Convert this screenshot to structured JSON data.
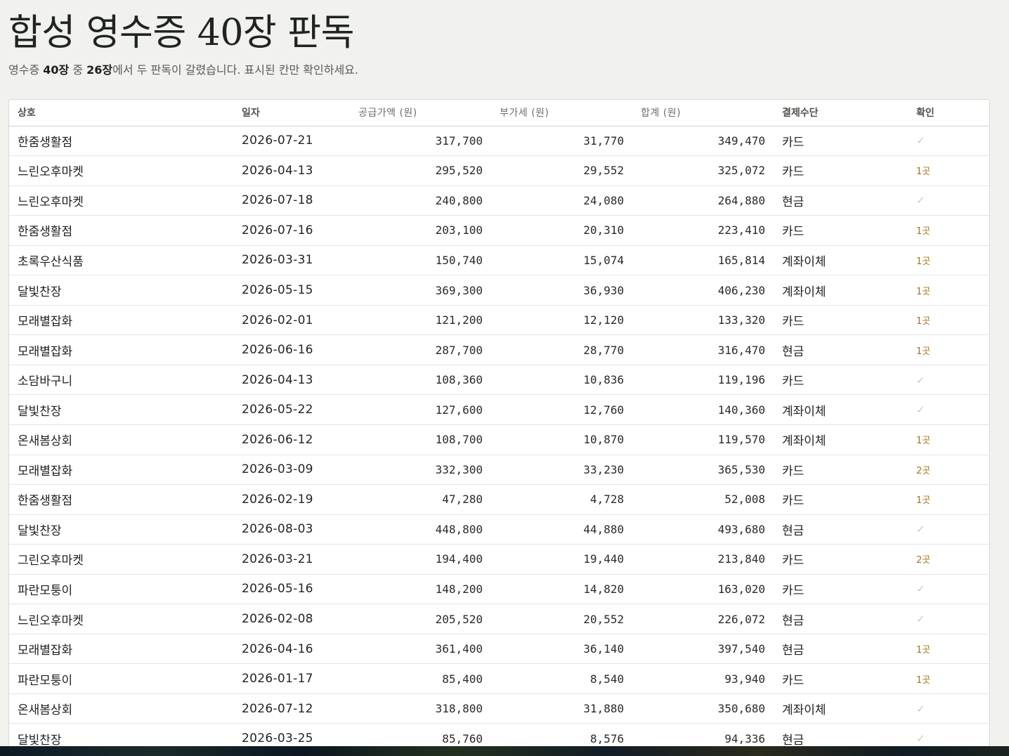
{
  "title": "합성 영수증 40장 판독",
  "subtitle": {
    "prefix": "영수증 ",
    "total": "40장",
    "middle": " 중 ",
    "disputed": "26장",
    "suffix": "에서 두 판독이 갈렸습니다. 표시된 칸만 확인하세요."
  },
  "table": {
    "columns": {
      "vendor": "상호",
      "date": "일자",
      "supply": "공급가액 (원)",
      "vat": "부가세 (원)",
      "total": "합계 (원)",
      "payment": "결제수단",
      "check": "확인"
    },
    "rows": [
      {
        "vendor": "한줌생활점",
        "date": "2026-07-21",
        "supply": "317,700",
        "vat": "31,770",
        "total": "349,470",
        "payment": "카드",
        "check": "✓",
        "flag": false
      },
      {
        "vendor": "느린오후마켓",
        "date": "2026-04-13",
        "supply": "295,520",
        "vat": "29,552",
        "total": "325,072",
        "payment": "카드",
        "check": "1곳",
        "flag": true
      },
      {
        "vendor": "느린오후마켓",
        "date": "2026-07-18",
        "supply": "240,800",
        "vat": "24,080",
        "total": "264,880",
        "payment": "현금",
        "check": "✓",
        "flag": false
      },
      {
        "vendor": "한줌생활점",
        "date": "2026-07-16",
        "supply": "203,100",
        "vat": "20,310",
        "total": "223,410",
        "payment": "카드",
        "check": "1곳",
        "flag": true
      },
      {
        "vendor": "초록우산식품",
        "date": "2026-03-31",
        "supply": "150,740",
        "vat": "15,074",
        "total": "165,814",
        "payment": "계좌이체",
        "check": "1곳",
        "flag": true
      },
      {
        "vendor": "달빛찬장",
        "date": "2026-05-15",
        "supply": "369,300",
        "vat": "36,930",
        "total": "406,230",
        "payment": "계좌이체",
        "check": "1곳",
        "flag": true
      },
      {
        "vendor": "모래별잡화",
        "date": "2026-02-01",
        "supply": "121,200",
        "vat": "12,120",
        "total": "133,320",
        "payment": "카드",
        "check": "1곳",
        "flag": true
      },
      {
        "vendor": "모래별잡화",
        "date": "2026-06-16",
        "supply": "287,700",
        "vat": "28,770",
        "total": "316,470",
        "payment": "현금",
        "check": "1곳",
        "flag": true
      },
      {
        "vendor": "소담바구니",
        "date": "2026-04-13",
        "supply": "108,360",
        "vat": "10,836",
        "total": "119,196",
        "payment": "카드",
        "check": "✓",
        "flag": false
      },
      {
        "vendor": "달빛찬장",
        "date": "2026-05-22",
        "supply": "127,600",
        "vat": "12,760",
        "total": "140,360",
        "payment": "계좌이체",
        "check": "✓",
        "flag": false
      },
      {
        "vendor": "온새봄상회",
        "date": "2026-06-12",
        "supply": "108,700",
        "vat": "10,870",
        "total": "119,570",
        "payment": "계좌이체",
        "check": "1곳",
        "flag": true
      },
      {
        "vendor": "모래별잡화",
        "date": "2026-03-09",
        "supply": "332,300",
        "vat": "33,230",
        "total": "365,530",
        "payment": "카드",
        "check": "2곳",
        "flag": true
      },
      {
        "vendor": "한줌생활점",
        "date": "2026-02-19",
        "supply": "47,280",
        "vat": "4,728",
        "total": "52,008",
        "payment": "카드",
        "check": "1곳",
        "flag": true
      },
      {
        "vendor": "달빛찬장",
        "date": "2026-08-03",
        "supply": "448,800",
        "vat": "44,880",
        "total": "493,680",
        "payment": "현금",
        "check": "✓",
        "flag": false
      },
      {
        "vendor": "그린오후마켓",
        "date": "2026-03-21",
        "supply": "194,400",
        "vat": "19,440",
        "total": "213,840",
        "payment": "카드",
        "check": "2곳",
        "flag": true
      },
      {
        "vendor": "파란모퉁이",
        "date": "2026-05-16",
        "supply": "148,200",
        "vat": "14,820",
        "total": "163,020",
        "payment": "카드",
        "check": "✓",
        "flag": false
      },
      {
        "vendor": "느린오후마켓",
        "date": "2026-02-08",
        "supply": "205,520",
        "vat": "20,552",
        "total": "226,072",
        "payment": "현금",
        "check": "✓",
        "flag": false
      },
      {
        "vendor": "모래별잡화",
        "date": "2026-04-16",
        "supply": "361,400",
        "vat": "36,140",
        "total": "397,540",
        "payment": "현금",
        "check": "1곳",
        "flag": true
      },
      {
        "vendor": "파란모퉁이",
        "date": "2026-01-17",
        "supply": "85,400",
        "vat": "8,540",
        "total": "93,940",
        "payment": "카드",
        "check": "1곳",
        "flag": true
      },
      {
        "vendor": "온새봄상회",
        "date": "2026-07-12",
        "supply": "318,800",
        "vat": "31,880",
        "total": "350,680",
        "payment": "계좌이체",
        "check": "✓",
        "flag": false
      },
      {
        "vendor": "달빛찬장",
        "date": "2026-03-25",
        "supply": "85,760",
        "vat": "8,576",
        "total": "94,336",
        "payment": "현금",
        "check": "✓",
        "flag": false
      }
    ]
  },
  "colors": {
    "background": "#f1f1ee",
    "flag": "#a8731a",
    "ok_check": "#c9cbc6"
  },
  "icons": {
    "ok": "check-icon"
  }
}
